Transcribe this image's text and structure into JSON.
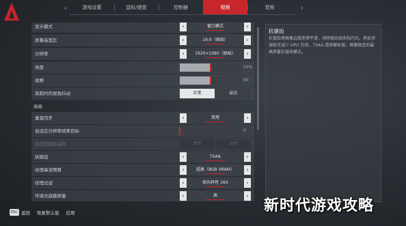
{
  "tabs": [
    {
      "label": "游戏设置",
      "active": false
    },
    {
      "label": "鼠标/键盘",
      "active": false
    },
    {
      "label": "控制器",
      "active": false
    },
    {
      "label": "视频",
      "active": true
    },
    {
      "label": "音频",
      "active": false
    }
  ],
  "colors": {
    "accent": "#c9262c",
    "background": "#24282d",
    "panel": "#3b4046"
  },
  "settings": {
    "display_mode": {
      "label": "显示模式",
      "value": "窗口模式"
    },
    "aspect_ratio": {
      "label": "屏幕高宽比",
      "value": "16:9（原始）"
    },
    "resolution": {
      "label": "分辨率",
      "value": "1920×1080（原始）"
    },
    "brightness": {
      "label": "亮度",
      "value": "50%",
      "level": 0.5
    },
    "fov": {
      "label": "视野",
      "value": "90",
      "level": 0.5
    },
    "sprint_shake": {
      "label": "奔跑时的视角抖动",
      "options": [
        "正常",
        "最低"
      ],
      "selected": "正常"
    },
    "advanced_header": "高级",
    "vsync": {
      "label": "垂直同步",
      "value": "禁用"
    },
    "adaptive_res": {
      "label": "自适应分辨率帧率目标",
      "value": "0",
      "level": 0.0
    },
    "adaptive_supersample": {
      "label": "自适应超级采样",
      "options": [
        "禁用",
        "启用"
      ],
      "disabled": true
    },
    "antialiasing": {
      "label": "抗锯齿",
      "value": "TSAA"
    },
    "texture_budget": {
      "label": "纹理串流预算",
      "value": "超高（8GB VRAM）"
    },
    "texture_filter": {
      "label": "纹理过滤",
      "value": "各向异性 16X"
    },
    "ambient_occlusion": {
      "label": "环境光遮蔽质量",
      "value": "高"
    }
  },
  "info": {
    "title": "抗锯齿",
    "description": "抗锯齿使图像边缘变得平滑，消除锯齿线条和闪光。将此项调低可减少 GPU 负荷。TSAA 提供解析度，图像稳定的最高质量抗锯齿模式。"
  },
  "footer": {
    "esc_key": "ESC",
    "back": "返回",
    "restore": "恢复默认值",
    "apply": "应用"
  },
  "watermark": "新时代游戏攻略"
}
